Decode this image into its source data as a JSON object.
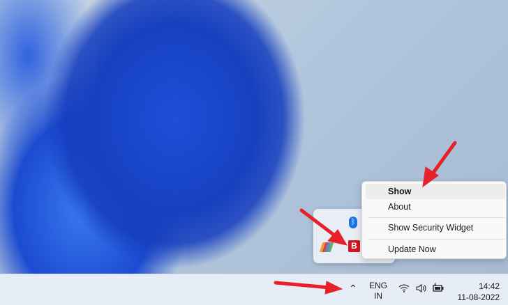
{
  "menu": {
    "items": [
      {
        "label": "Show"
      },
      {
        "label": "About"
      },
      {
        "label": "Show Security Widget"
      },
      {
        "label": "Update Now"
      }
    ]
  },
  "taskbar": {
    "language": "ENG",
    "region": "IN",
    "time": "14:42",
    "date": "11-08-2022"
  },
  "tray": {
    "icons": [
      "bluetooth-icon",
      "colorful-app-icon",
      "bitdefender-icon"
    ]
  },
  "colors": {
    "accent_arrow": "#e8202a",
    "bitdefender": "#d0161e",
    "bluetooth": "#1a73e8"
  }
}
